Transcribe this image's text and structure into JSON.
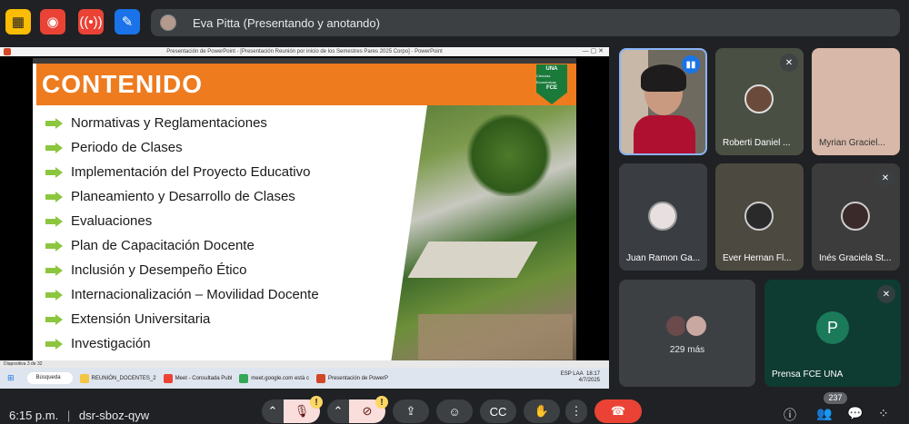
{
  "topbar": {
    "presenter_text": "Eva Pitta (Presentando y anotando)"
  },
  "ppt": {
    "window_title": "Presentación de PowerPoint - [Presentación Reunión por inicio de los Semestres Pares 2025 Corpo] - PowerPoint",
    "slide_title": "CONTENIDO",
    "logo_top": "UNA",
    "logo_mid": "Ciencias Económicas",
    "logo_bot": "FCE",
    "items": [
      "Normativas y Reglamentaciones",
      "Periodo de Clases",
      "Implementación del Proyecto Educativo",
      "Planeamiento y Desarrollo de Clases",
      "Evaluaciones",
      "Plan de Capacitación Docente",
      "Inclusión y Desempeño Ético",
      "Internacionalización – Movilidad Docente",
      "Extensión Universitaria",
      "Investigación"
    ],
    "status_text": "Diapositiva 3 de 32",
    "taskbar": {
      "search": "Búsqueda",
      "apps": [
        "REUNIÓN_DOCENTES_2",
        "Meet - Consultada Publ",
        "meet.google.com está c",
        "Presentación de PowerP"
      ],
      "tray_lang": "ESP LAA",
      "tray_time": "18:17",
      "tray_date": "4/7/2025"
    }
  },
  "participants": [
    {
      "name": "",
      "speaking": true
    },
    {
      "name": "Roberti Daniel ...",
      "muted": true
    },
    {
      "name": "Myrian Graciel...",
      "muted": false
    },
    {
      "name": "Juan Ramon Ga...",
      "muted": false
    },
    {
      "name": "Ever Hernan Fl...",
      "muted": false
    },
    {
      "name": "Inés Graciela St...",
      "muted": true
    }
  ],
  "more": {
    "label": "229 más"
  },
  "pfce": {
    "initial": "P",
    "name": "Prensa FCE UNA"
  },
  "bottom": {
    "time": "6:15 p.m.",
    "separator": "|",
    "meeting_code": "dsr-sboz-qyw",
    "participant_count": "237",
    "warn_glyph": "!"
  },
  "colors": {
    "slide_orange": "#ee7b1e",
    "arrow_green": "#8cc63f",
    "hangup_red": "#ea4335",
    "meet_bg": "#202124"
  }
}
